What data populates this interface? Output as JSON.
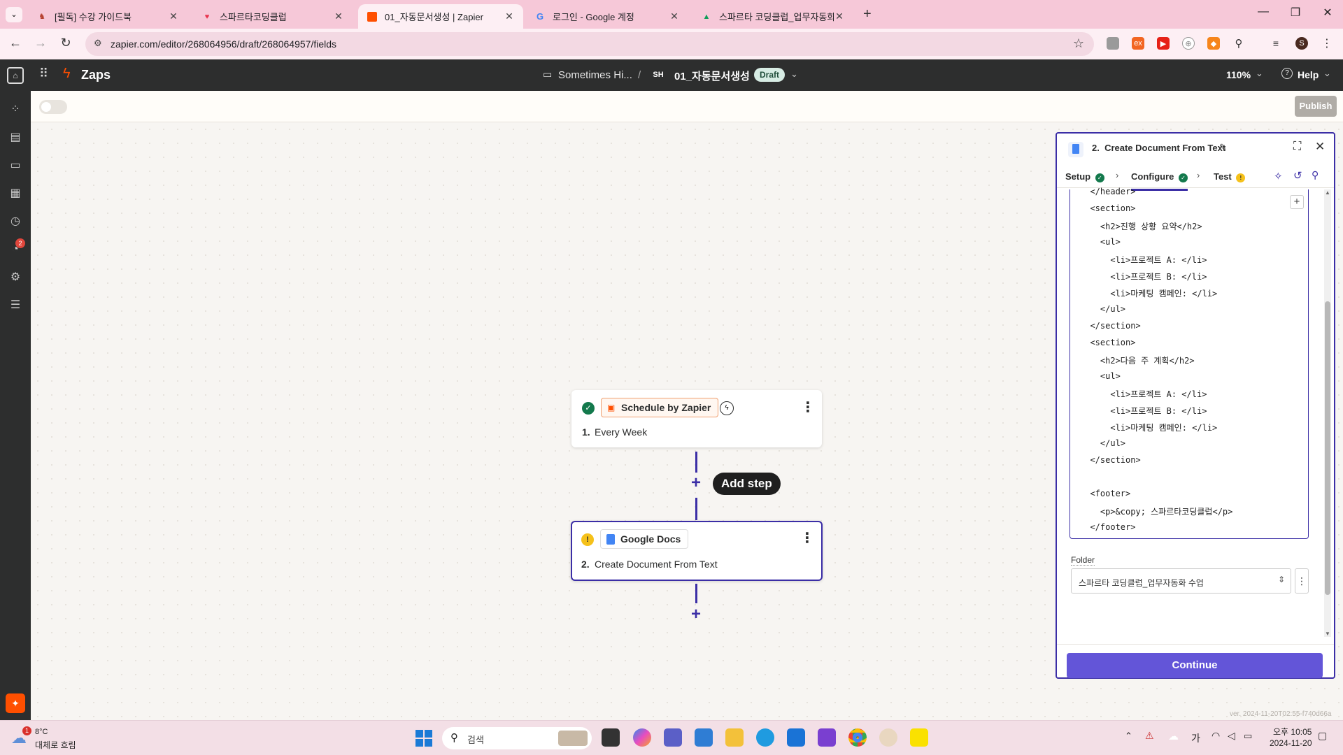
{
  "browser": {
    "tabs": [
      {
        "title": "[필독] 수강 가이드북",
        "active": false
      },
      {
        "title": "스파르타코딩클럽",
        "active": false
      },
      {
        "title": "01_자동문서생성 | Zapier",
        "active": true
      },
      {
        "title": "로그인 - Google 계정",
        "active": false
      },
      {
        "title": "스파르타 코딩클럽_업무자동화",
        "active": false
      }
    ],
    "url": "zapier.com/editor/268064956/draft/268064957/fields",
    "profile_initial": "S"
  },
  "zapier_header": {
    "app_name": "Zaps",
    "folder": "Sometimes Hi...",
    "separator": "/",
    "owner_initials": "SH",
    "zap_name": "01_자동문서생성",
    "status_badge": "Draft",
    "zoom": "110%",
    "help": "Help"
  },
  "rail": {
    "notification_count": "2"
  },
  "subbar": {
    "publish": "Publish"
  },
  "canvas": {
    "step1": {
      "app": "Schedule by Zapier",
      "number": "1.",
      "title": "Every Week"
    },
    "add_step": "Add step",
    "step2": {
      "app": "Google Docs",
      "number": "2.",
      "title": "Create Document From Text"
    }
  },
  "panel": {
    "title": "2.  Create Document From Text",
    "tabs": {
      "setup": "Setup",
      "configure": "Configure",
      "test": "Test"
    },
    "code_lines": [
      "  </header>",
      "  <section>",
      "    <h2>진행 상황 요약</h2>",
      "    <ul>",
      "      <li>프로젝트 A: </li>",
      "      <li>프로젝트 B: </li>",
      "      <li>마케팅 캠페인: </li>",
      "    </ul>",
      "  </section>",
      "  <section>",
      "    <h2>다음 주 계획</h2>",
      "    <ul>",
      "      <li>프로젝트 A: </li>",
      "      <li>프로젝트 B: </li>",
      "      <li>마케팅 캠페인: </li>",
      "    </ul>",
      "  </section>",
      "",
      "  <footer>",
      "    <p>&copy; 스파르타코딩클럽</p>",
      "  </footer>"
    ],
    "folder_label": "Folder",
    "folder_value": "스파르타 코딩클럽_업무자동화 수업",
    "continue": "Continue"
  },
  "version": "ver. 2024-11-20T02:55-f740d66a",
  "taskbar": {
    "weather_temp": "8°C",
    "weather_desc": "대체로 흐림",
    "weather_badge": "1",
    "search_placeholder": "검색",
    "ime": "가",
    "time": "오후 10:05",
    "date": "2024-11-20"
  },
  "colors": {
    "accent": "#3b2ea6",
    "zapier_orange": "#ff4f00",
    "continue_bg": "#6355d8"
  }
}
